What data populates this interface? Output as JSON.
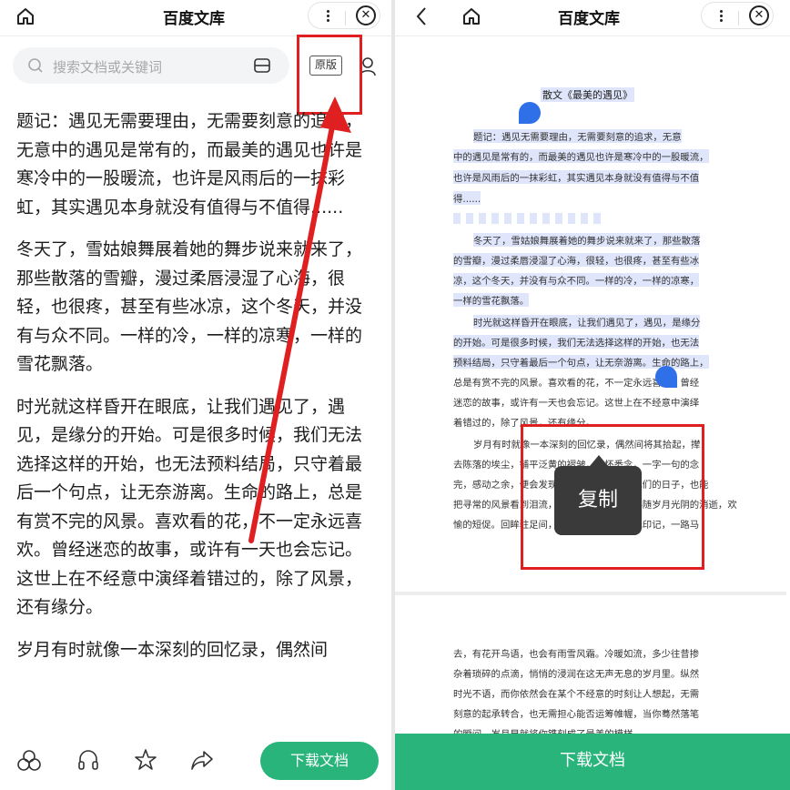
{
  "left": {
    "header": {
      "title": "百度文库"
    },
    "search": {
      "placeholder": "搜索文档或关键词"
    },
    "original_button": "原版",
    "article": {
      "paragraphs": [
        "题记：遇见无需要理由，无需要刻意的追求，无意中的遇见是常有的，而最美的遇见也许是寒冷中的一股暖流，也许是风雨后的一抹彩虹，其实遇见本身就没有值得与不值得......",
        "冬天了，雪姑娘舞展着她的舞步说来就来了，那些散落的雪瓣，漫过柔唇浸湿了心海，很轻，也很疼，甚至有些冰凉，这个冬天，并没有与众不同。一样的冷，一样的凉寒，一样的雪花飘落。",
        "时光就这样昏开在眼底，让我们遇见了，遇见，是缘分的开始。可是很多时候，我们无法选择这样的开始，也无法预料结局，只守着最后一个句点，让无奈游离。生命的路上，总是有赏不完的风景。喜欢看的花，不一定永远喜欢。曾经迷恋的故事，或许有一天也会忘记。这世上在不经意中演绎着错过的，除了风景，还有缘分。",
        "岁月有时就像一本深刻的回忆录，偶然间"
      ]
    },
    "bottom": {
      "download_label": "下载文档"
    }
  },
  "right": {
    "header": {
      "title": "百度文库"
    },
    "doc_title": "散文《最美的遇见》",
    "lines": [
      "题记：遇见无需要理由，无需要刻意的追求，无意",
      "中的遇见是常有的，而最美的遇见也许是寒冷中的一股暖流，",
      "也许是风雨后的一抹彩虹，其实遇见本身就没有值得与不值",
      "得......",
      "冬天了，雪姑娘舞展着她的舞步说来就来了，那些散落",
      "的雪瓣，漫过柔唇浸湿了心海，很轻，也很疼，甚至有些冰",
      "凉，这个冬天，并没有与众不同。一样的冷，一样的凉寒，",
      "一样的雪花飘落。",
      "时光就这样昏开在眼底，让我们遇见了，遇见，是缘分",
      "的开始。可是很多时候，我们无法选择这样的开始，也无法",
      "预料结局，只守着最后一个句点，让无奈游离。生命的路上，",
      "总是有赏不完的风景。喜欢看的花，不一定永远喜欢。曾经",
      "迷恋的故事，或许有一天也会忘记。这世上在不经意中演绎",
      "着错过的，除了风景，还有缘分。",
      "岁月有时就像一本深刻的回忆录，偶然间将其拾起，撵",
      "去陈落的埃尘，铺平泛黄的褶皱，心怀悉念，一字一句的念",
      "完，感动之余，便会发现它记载着的原来是我们的日子，也能",
      "把寻常的风景看到泪流，一页页记录，都是伴随岁月光阴的消逝，欢",
      "愉的短促。回眸驻足间，才发现遇见时的深浅印记，一路马"
    ],
    "lines_page2": [
      "去，有花开鸟语，也会有雨雪风霜。冷暖如流，多少往昔掺",
      "杂着琐碎的点滴，悄悄的浸润在这无声无息的岁月里。纵然",
      "时光不语，而你依然会在某个不经意的时刻让人想起，无需",
      "刻意的起承转合，也无需担心能否运筹帷幄，当你蓦然落笔",
      "的瞬间，岁月早就将你镌刻成了最美的模样。"
    ],
    "copy_label": "复制",
    "bottom": {
      "download_label": "下载文档"
    }
  },
  "colors": {
    "accent_green": "#28b47a",
    "highlight_blue": "#dfe6fb",
    "handle_blue": "#2f6fe8",
    "annotation_red": "#e02020"
  }
}
